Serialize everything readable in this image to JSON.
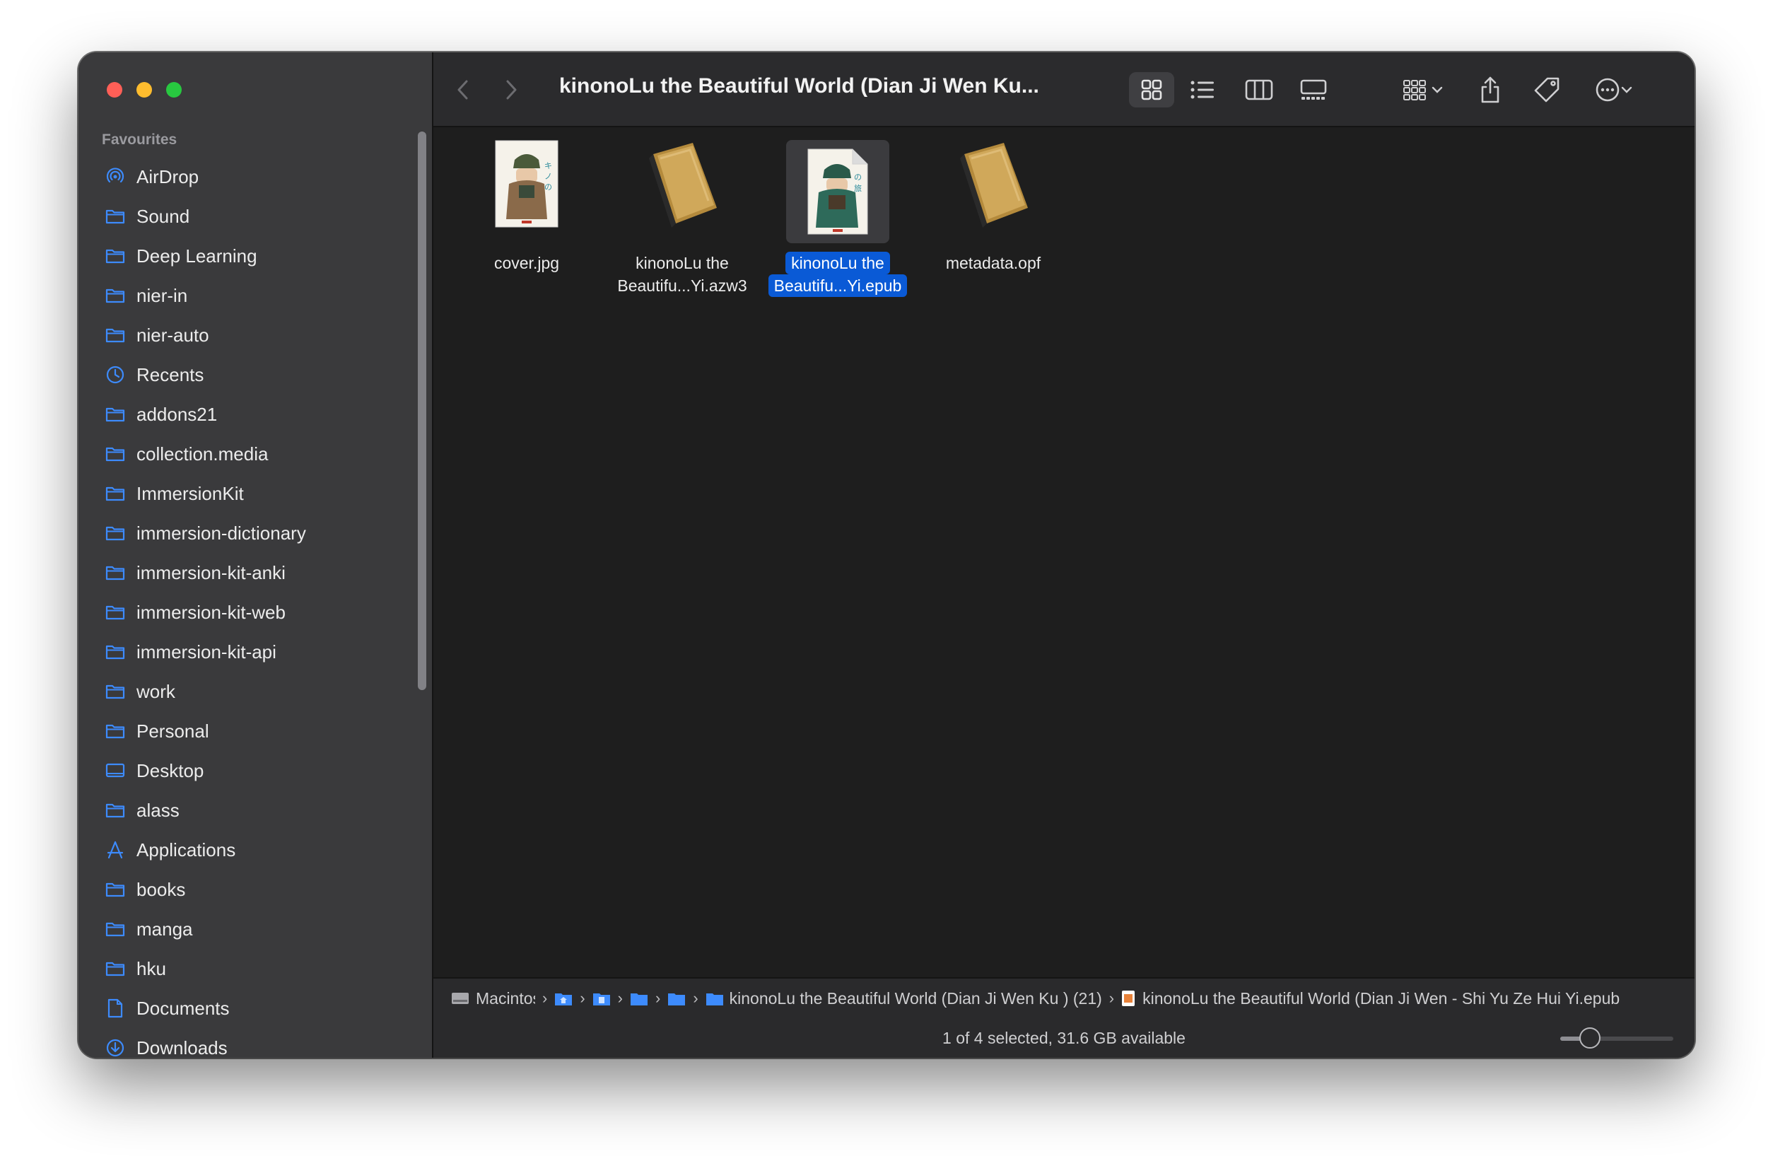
{
  "window": {
    "title": "kinonoLu  the Beautiful World (Dian Ji Wen Ku..."
  },
  "sidebar": {
    "section_title": "Favourites",
    "items": [
      {
        "label": "AirDrop",
        "icon": "airdrop-icon"
      },
      {
        "label": "Sound",
        "icon": "folder-icon"
      },
      {
        "label": "Deep Learning",
        "icon": "folder-icon"
      },
      {
        "label": "nier-in",
        "icon": "folder-icon"
      },
      {
        "label": "nier-auto",
        "icon": "folder-icon"
      },
      {
        "label": "Recents",
        "icon": "clock-icon"
      },
      {
        "label": "addons21",
        "icon": "folder-icon"
      },
      {
        "label": "collection.media",
        "icon": "folder-icon"
      },
      {
        "label": "ImmersionKit",
        "icon": "folder-icon"
      },
      {
        "label": "immersion-dictionary",
        "icon": "folder-icon"
      },
      {
        "label": "immersion-kit-anki",
        "icon": "folder-icon"
      },
      {
        "label": "immersion-kit-web",
        "icon": "folder-icon"
      },
      {
        "label": "immersion-kit-api",
        "icon": "folder-icon"
      },
      {
        "label": "work",
        "icon": "folder-icon"
      },
      {
        "label": "Personal",
        "icon": "folder-icon"
      },
      {
        "label": "Desktop",
        "icon": "desktop-icon"
      },
      {
        "label": "alass",
        "icon": "folder-icon"
      },
      {
        "label": "Applications",
        "icon": "applications-icon"
      },
      {
        "label": "books",
        "icon": "folder-icon"
      },
      {
        "label": "manga",
        "icon": "folder-icon"
      },
      {
        "label": "hku",
        "icon": "folder-icon"
      },
      {
        "label": "Documents",
        "icon": "document-icon"
      },
      {
        "label": "Downloads",
        "icon": "download-icon"
      }
    ]
  },
  "files": [
    {
      "name_line1": "cover.jpg",
      "name_line2": "",
      "kind": "image-thumbnail",
      "selected": false
    },
    {
      "name_line1": "kinonoLu  the",
      "name_line2": "Beautifu...Yi.azw3",
      "kind": "book-icon",
      "selected": false
    },
    {
      "name_line1": "kinonoLu  the",
      "name_line2": "Beautifu...Yi.epub",
      "kind": "image-thumbnail",
      "selected": true
    },
    {
      "name_line1": "metadata.opf",
      "name_line2": "",
      "kind": "book-icon",
      "selected": false
    }
  ],
  "pathbar": {
    "root": "Macintosh",
    "folder_parent": "kinonoLu  the Beautiful World (Dian Ji Wen Ku ) (21)",
    "file": "kinonoLu  the Beautiful World (Dian Ji Wen - Shi Yu Ze  Hui Yi.epub"
  },
  "status": {
    "text": "1 of 4 selected, 31.6 GB available",
    "icon_size_level": 0.26
  },
  "colors": {
    "accent": "#0a5ad6",
    "folder": "#3d8bfd",
    "window_bg": "#1e1e1e",
    "sidebar_bg": "#3a3a3c"
  }
}
